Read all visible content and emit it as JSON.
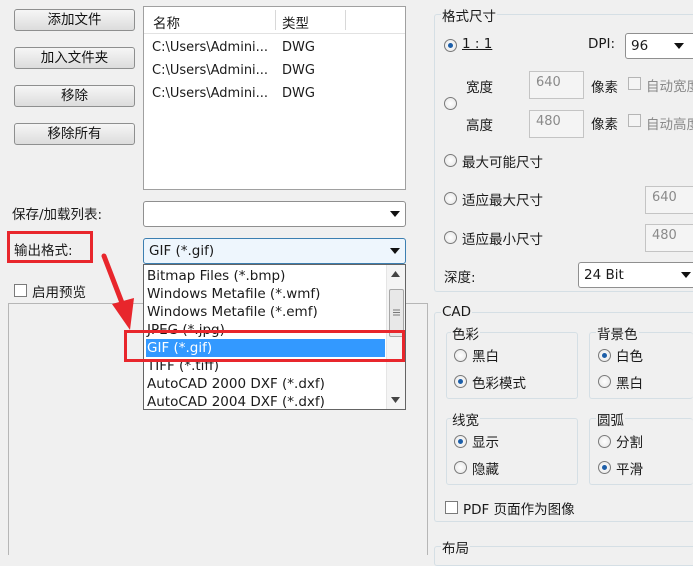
{
  "left_panel": {
    "buttons": {
      "add_file": "添加文件",
      "add_folder": "加入文件夹",
      "remove": "移除",
      "remove_all": "移除所有"
    },
    "file_list": {
      "columns": [
        "名称",
        "类型"
      ],
      "rows": [
        {
          "name": "C:\\Users\\Admini...",
          "type": "DWG"
        },
        {
          "name": "C:\\Users\\Admini...",
          "type": "DWG"
        },
        {
          "name": "C:\\Users\\Admini...",
          "type": "DWG"
        }
      ]
    },
    "save_load_label": "保存/加载列表:",
    "save_load_value": "",
    "output_format_label": "输出格式:",
    "output_format_value": "GIF (*.gif)",
    "enable_preview_label": "启用预览",
    "format_options": [
      "Bitmap Files (*.bmp)",
      "Windows Metafile (*.wmf)",
      "Windows Metafile (*.emf)",
      "JPEG (*.jpg)",
      "GIF (*.gif)",
      "TIFF (*.tiff)",
      "AutoCAD 2000 DXF (*.dxf)",
      "AutoCAD 2004 DXF (*.dxf)"
    ],
    "selected_option_index": 4
  },
  "right_panel": {
    "format_size_title": "格式尺寸",
    "ratio_label": "1 : 1",
    "dpi_label": "DPI:",
    "dpi_value": "96",
    "width_label": "宽度",
    "width_value": "640",
    "height_label": "高度",
    "height_value": "480",
    "pixel_label": "像素",
    "auto_width": "自动宽度",
    "auto_height": "自动高度",
    "max_possible": "最大可能尺寸",
    "fit_max": "适应最大尺寸",
    "fit_max_value": "640",
    "fit_min": "适应最小尺寸",
    "fit_min_value": "480",
    "depth_label": "深度:",
    "depth_value": "24 Bit",
    "cad": {
      "title": "CAD",
      "color_group": "色彩",
      "bw": "黑白",
      "color_mode": "色彩模式",
      "bg_group": "背景色",
      "white": "白色",
      "black": "黑白",
      "linewidth_group": "线宽",
      "show": "显示",
      "hide": "隐藏",
      "arc_group": "圆弧",
      "split": "分割",
      "smooth": "平滑",
      "pdf_label": "PDF 页面作为图像"
    },
    "layout_title": "布局"
  },
  "colors": {
    "highlight": "#3399ff",
    "annotation_red": "#e8262c"
  }
}
